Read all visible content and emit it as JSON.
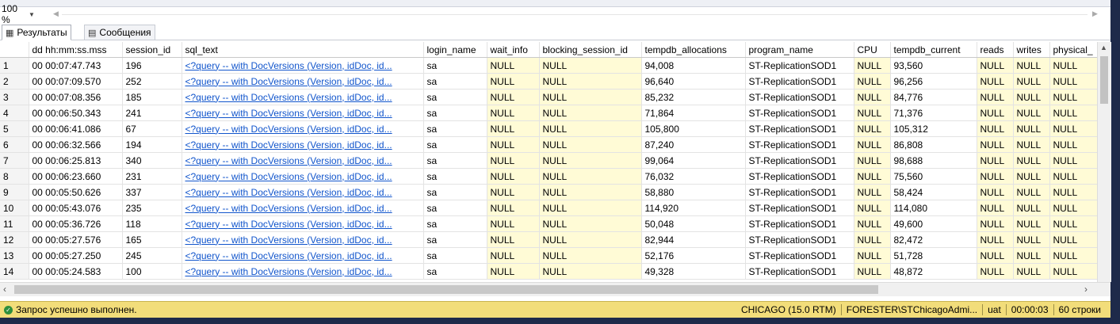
{
  "zoom": {
    "value": "100 %"
  },
  "tabs": [
    {
      "label": "Результаты",
      "icon": "grid-icon"
    },
    {
      "label": "Сообщения",
      "icon": "messages-icon"
    }
  ],
  "grid": {
    "columns": [
      "dd hh:mm:ss.mss",
      "session_id",
      "sql_text",
      "login_name",
      "wait_info",
      "blocking_session_id",
      "tempdb_allocations",
      "program_name",
      "CPU",
      "tempdb_current",
      "reads",
      "writes",
      "physical_"
    ],
    "rows": [
      [
        "1",
        "00 00:07:47.743",
        "196",
        "<?query -- with DocVersions (Version, idDoc, id...",
        "sa",
        "NULL",
        "NULL",
        "94,008",
        "ST-ReplicationSOD1",
        "NULL",
        "93,560",
        "NULL",
        "NULL",
        "NULL"
      ],
      [
        "2",
        "00 00:07:09.570",
        "252",
        "<?query -- with DocVersions (Version, idDoc, id...",
        "sa",
        "NULL",
        "NULL",
        "96,640",
        "ST-ReplicationSOD1",
        "NULL",
        "96,256",
        "NULL",
        "NULL",
        "NULL"
      ],
      [
        "3",
        "00 00:07:08.356",
        "185",
        "<?query -- with DocVersions (Version, idDoc, id...",
        "sa",
        "NULL",
        "NULL",
        "85,232",
        "ST-ReplicationSOD1",
        "NULL",
        "84,776",
        "NULL",
        "NULL",
        "NULL"
      ],
      [
        "4",
        "00 00:06:50.343",
        "241",
        "<?query -- with DocVersions (Version, idDoc, id...",
        "sa",
        "NULL",
        "NULL",
        "71,864",
        "ST-ReplicationSOD1",
        "NULL",
        "71,376",
        "NULL",
        "NULL",
        "NULL"
      ],
      [
        "5",
        "00 00:06:41.086",
        "67",
        "<?query -- with DocVersions (Version, idDoc, id...",
        "sa",
        "NULL",
        "NULL",
        "105,800",
        "ST-ReplicationSOD1",
        "NULL",
        "105,312",
        "NULL",
        "NULL",
        "NULL"
      ],
      [
        "6",
        "00 00:06:32.566",
        "194",
        "<?query -- with DocVersions (Version, idDoc, id...",
        "sa",
        "NULL",
        "NULL",
        "87,240",
        "ST-ReplicationSOD1",
        "NULL",
        "86,808",
        "NULL",
        "NULL",
        "NULL"
      ],
      [
        "7",
        "00 00:06:25.813",
        "340",
        "<?query -- with DocVersions (Version, idDoc, id...",
        "sa",
        "NULL",
        "NULL",
        "99,064",
        "ST-ReplicationSOD1",
        "NULL",
        "98,688",
        "NULL",
        "NULL",
        "NULL"
      ],
      [
        "8",
        "00 00:06:23.660",
        "231",
        "<?query -- with DocVersions (Version, idDoc, id...",
        "sa",
        "NULL",
        "NULL",
        "76,032",
        "ST-ReplicationSOD1",
        "NULL",
        "75,560",
        "NULL",
        "NULL",
        "NULL"
      ],
      [
        "9",
        "00 00:05:50.626",
        "337",
        "<?query -- with DocVersions (Version, idDoc, id...",
        "sa",
        "NULL",
        "NULL",
        "58,880",
        "ST-ReplicationSOD1",
        "NULL",
        "58,424",
        "NULL",
        "NULL",
        "NULL"
      ],
      [
        "10",
        "00 00:05:43.076",
        "235",
        "<?query -- with DocVersions (Version, idDoc, id...",
        "sa",
        "NULL",
        "NULL",
        "114,920",
        "ST-ReplicationSOD1",
        "NULL",
        "114,080",
        "NULL",
        "NULL",
        "NULL"
      ],
      [
        "11",
        "00 00:05:36.726",
        "118",
        "<?query -- with DocVersions (Version, idDoc, id...",
        "sa",
        "NULL",
        "NULL",
        "50,048",
        "ST-ReplicationSOD1",
        "NULL",
        "49,600",
        "NULL",
        "NULL",
        "NULL"
      ],
      [
        "12",
        "00 00:05:27.576",
        "165",
        "<?query -- with DocVersions (Version, idDoc, id...",
        "sa",
        "NULL",
        "NULL",
        "82,944",
        "ST-ReplicationSOD1",
        "NULL",
        "82,472",
        "NULL",
        "NULL",
        "NULL"
      ],
      [
        "13",
        "00 00:05:27.250",
        "245",
        "<?query -- with DocVersions (Version, idDoc, id...",
        "sa",
        "NULL",
        "NULL",
        "52,176",
        "ST-ReplicationSOD1",
        "NULL",
        "51,728",
        "NULL",
        "NULL",
        "NULL"
      ],
      [
        "14",
        "00 00:05:24.583",
        "100",
        "<?query -- with DocVersions (Version, idDoc, id...",
        "sa",
        "NULL",
        "NULL",
        "49,328",
        "ST-ReplicationSOD1",
        "NULL",
        "48,872",
        "NULL",
        "NULL",
        "NULL"
      ]
    ]
  },
  "status": {
    "message": "Запрос успешно выполнен.",
    "server": "CHICAGO (15.0 RTM)",
    "user": "FORESTER\\STChicagoAdmi...",
    "database": "uat",
    "elapsed": "00:00:03",
    "rowcount": "60 строки"
  },
  "colors": {
    "status_bg": "#f2dd7a",
    "link": "#1155cc",
    "highlight_cell": "#fffbd6",
    "success": "#2f8f3d"
  }
}
